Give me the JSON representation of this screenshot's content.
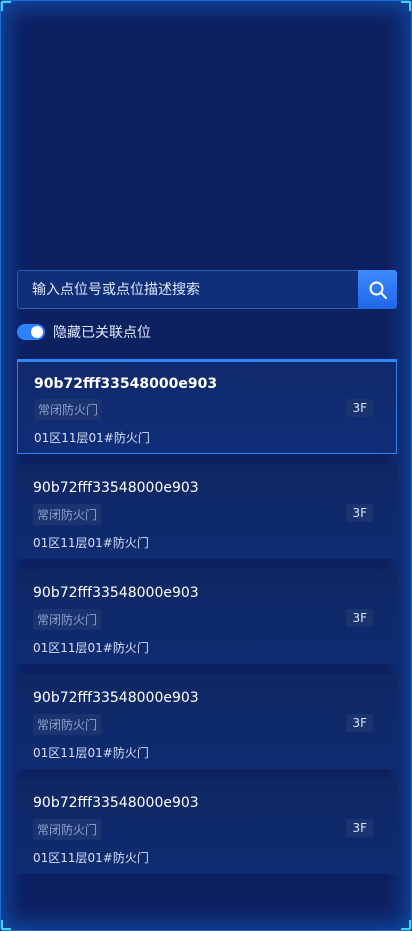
{
  "search": {
    "placeholder": "输入点位号或点位描述搜索",
    "button_icon": "search-icon"
  },
  "toggle": {
    "label": "隐藏已关联点位",
    "checked": true
  },
  "colors": {
    "accent": "#2f82ff",
    "panel_bg": "#0d2060",
    "frame_glow": "#1a6fd6"
  },
  "points": [
    {
      "code": "90b72fff33548000e903",
      "type": "常闭防火门",
      "floor": "3F",
      "location": "01区11层01#防火门",
      "selected": true
    },
    {
      "code": "90b72fff33548000e903",
      "type": "常闭防火门",
      "floor": "3F",
      "location": "01区11层01#防火门",
      "selected": false
    },
    {
      "code": "90b72fff33548000e903",
      "type": "常闭防火门",
      "floor": "3F",
      "location": "01区11层01#防火门",
      "selected": false
    },
    {
      "code": "90b72fff33548000e903",
      "type": "常闭防火门",
      "floor": "3F",
      "location": "01区11层01#防火门",
      "selected": false
    },
    {
      "code": "90b72fff33548000e903",
      "type": "常闭防火门",
      "floor": "3F",
      "location": "01区11层01#防火门",
      "selected": false
    }
  ]
}
